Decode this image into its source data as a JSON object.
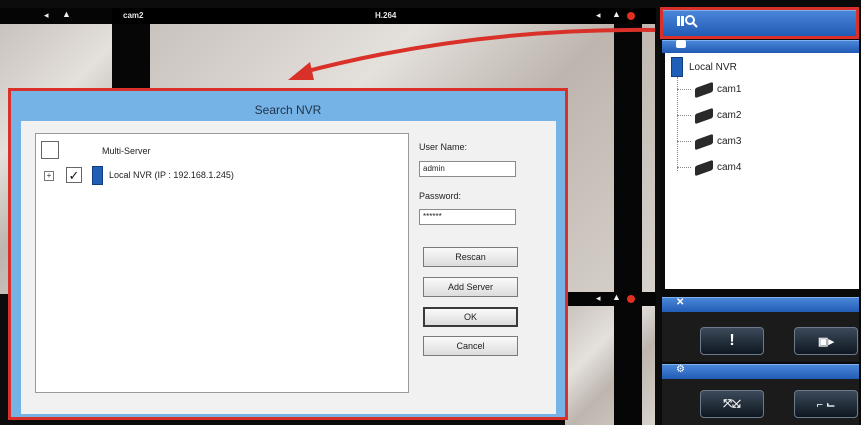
{
  "camera_view": {
    "left_cam_label": "",
    "cam2_label": "cam2",
    "codec": "H.264"
  },
  "search_panel": {
    "header_icon": "search-icon"
  },
  "device_tree": {
    "root": "Local NVR",
    "cameras": [
      "cam1",
      "cam2",
      "cam3",
      "cam4"
    ]
  },
  "control_panel": {
    "alarm_button": "!",
    "record_button": "▣▸"
  },
  "dialog": {
    "title": "Search NVR",
    "multi_server_label": "Multi-Server",
    "server_entry": "Local NVR (IP : 192.168.1.245)",
    "server_checked": true,
    "user_name_label": "User Name:",
    "user_name_value": "admin",
    "password_label": "Password:",
    "password_value": "******",
    "rescan_button": "Rescan",
    "add_server_button": "Add Server",
    "ok_button": "OK",
    "cancel_button": "Cancel"
  },
  "accent_colors": {
    "highlight_red": "#d9312a",
    "header_blue": "#1f59b3"
  }
}
